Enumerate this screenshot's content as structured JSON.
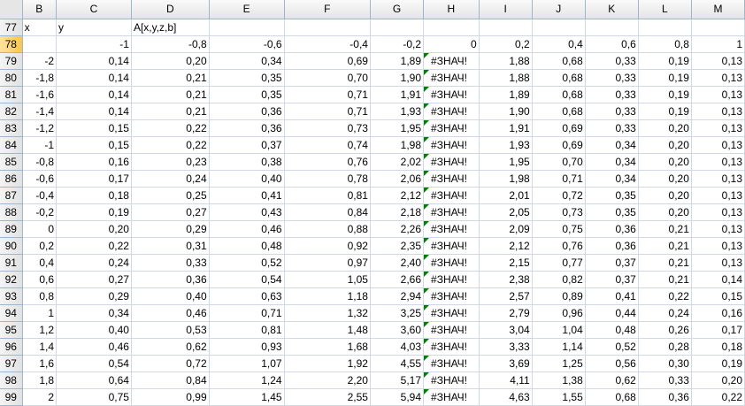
{
  "columns": [
    "B",
    "C",
    "D",
    "E",
    "F",
    "G",
    "H",
    "I",
    "J",
    "K",
    "L",
    "M"
  ],
  "rows": [
    {
      "n": "77",
      "cells": [
        "x",
        "y",
        "A[x,y,z,b]",
        "",
        "",
        "",
        "",
        "",
        "",
        "",
        "",
        ""
      ]
    },
    {
      "n": "78",
      "cells": [
        "",
        "-1",
        "-0,8",
        "-0,6",
        "-0,4",
        "-0,2",
        "0",
        "0,2",
        "0,4",
        "0,6",
        "0,8",
        "1"
      ]
    },
    {
      "n": "79",
      "cells": [
        "-2",
        "0,14",
        "0,20",
        "0,34",
        "0,69",
        "1,89",
        "#ЗНАЧ!",
        "1,88",
        "0,68",
        "0,33",
        "0,19",
        "0,13"
      ]
    },
    {
      "n": "80",
      "cells": [
        "-1,8",
        "0,14",
        "0,21",
        "0,35",
        "0,70",
        "1,90",
        "#ЗНАЧ!",
        "1,88",
        "0,68",
        "0,33",
        "0,19",
        "0,13"
      ]
    },
    {
      "n": "81",
      "cells": [
        "-1,6",
        "0,14",
        "0,21",
        "0,35",
        "0,71",
        "1,91",
        "#ЗНАЧ!",
        "1,89",
        "0,68",
        "0,33",
        "0,19",
        "0,13"
      ]
    },
    {
      "n": "82",
      "cells": [
        "-1,4",
        "0,14",
        "0,21",
        "0,36",
        "0,71",
        "1,93",
        "#ЗНАЧ!",
        "1,90",
        "0,68",
        "0,33",
        "0,19",
        "0,13"
      ]
    },
    {
      "n": "83",
      "cells": [
        "-1,2",
        "0,15",
        "0,22",
        "0,36",
        "0,73",
        "1,95",
        "#ЗНАЧ!",
        "1,91",
        "0,69",
        "0,33",
        "0,20",
        "0,13"
      ]
    },
    {
      "n": "84",
      "cells": [
        "-1",
        "0,15",
        "0,22",
        "0,37",
        "0,74",
        "1,98",
        "#ЗНАЧ!",
        "1,93",
        "0,69",
        "0,34",
        "0,20",
        "0,13"
      ]
    },
    {
      "n": "85",
      "cells": [
        "-0,8",
        "0,16",
        "0,23",
        "0,38",
        "0,76",
        "2,02",
        "#ЗНАЧ!",
        "1,95",
        "0,70",
        "0,34",
        "0,20",
        "0,13"
      ]
    },
    {
      "n": "86",
      "cells": [
        "-0,6",
        "0,17",
        "0,24",
        "0,40",
        "0,78",
        "2,06",
        "#ЗНАЧ!",
        "1,98",
        "0,71",
        "0,34",
        "0,20",
        "0,13"
      ]
    },
    {
      "n": "87",
      "cells": [
        "-0,4",
        "0,18",
        "0,25",
        "0,41",
        "0,81",
        "2,12",
        "#ЗНАЧ!",
        "2,01",
        "0,72",
        "0,35",
        "0,20",
        "0,13"
      ]
    },
    {
      "n": "88",
      "cells": [
        "-0,2",
        "0,19",
        "0,27",
        "0,43",
        "0,84",
        "2,18",
        "#ЗНАЧ!",
        "2,05",
        "0,73",
        "0,35",
        "0,20",
        "0,13"
      ]
    },
    {
      "n": "89",
      "cells": [
        "0",
        "0,20",
        "0,29",
        "0,46",
        "0,88",
        "2,26",
        "#ЗНАЧ!",
        "2,09",
        "0,75",
        "0,36",
        "0,21",
        "0,13"
      ]
    },
    {
      "n": "90",
      "cells": [
        "0,2",
        "0,22",
        "0,31",
        "0,48",
        "0,92",
        "2,35",
        "#ЗНАЧ!",
        "2,12",
        "0,76",
        "0,36",
        "0,21",
        "0,13"
      ]
    },
    {
      "n": "91",
      "cells": [
        "0,4",
        "0,24",
        "0,33",
        "0,52",
        "0,97",
        "2,40",
        "#ЗНАЧ!",
        "2,15",
        "0,77",
        "0,37",
        "0,21",
        "0,13"
      ]
    },
    {
      "n": "92",
      "cells": [
        "0,6",
        "0,27",
        "0,36",
        "0,54",
        "1,05",
        "2,66",
        "#ЗНАЧ!",
        "2,38",
        "0,82",
        "0,37",
        "0,21",
        "0,14"
      ]
    },
    {
      "n": "93",
      "cells": [
        "0,8",
        "0,29",
        "0,40",
        "0,63",
        "1,18",
        "2,94",
        "#ЗНАЧ!",
        "2,57",
        "0,89",
        "0,41",
        "0,22",
        "0,15"
      ]
    },
    {
      "n": "94",
      "cells": [
        "1",
        "0,34",
        "0,46",
        "0,71",
        "1,32",
        "3,25",
        "#ЗНАЧ!",
        "2,79",
        "0,96",
        "0,44",
        "0,24",
        "0,16"
      ]
    },
    {
      "n": "95",
      "cells": [
        "1,2",
        "0,40",
        "0,53",
        "0,81",
        "1,48",
        "3,60",
        "#ЗНАЧ!",
        "3,04",
        "1,04",
        "0,48",
        "0,26",
        "0,17"
      ]
    },
    {
      "n": "96",
      "cells": [
        "1,4",
        "0,46",
        "0,62",
        "0,93",
        "1,68",
        "4,03",
        "#ЗНАЧ!",
        "3,33",
        "1,14",
        "0,52",
        "0,28",
        "0,18"
      ]
    },
    {
      "n": "97",
      "cells": [
        "1,6",
        "0,54",
        "0,72",
        "1,07",
        "1,92",
        "4,55",
        "#ЗНАЧ!",
        "3,69",
        "1,25",
        "0,56",
        "0,30",
        "0,19"
      ]
    },
    {
      "n": "98",
      "cells": [
        "1,8",
        "0,64",
        "0,84",
        "1,24",
        "2,20",
        "5,17",
        "#ЗНАЧ!",
        "4,11",
        "1,38",
        "0,62",
        "0,33",
        "0,20"
      ]
    },
    {
      "n": "99",
      "cells": [
        "2",
        "0,75",
        "0,99",
        "1,45",
        "2,55",
        "5,94",
        "#ЗНАЧ!",
        "4,63",
        "1,55",
        "0,68",
        "0,36",
        "0,22"
      ]
    }
  ],
  "active_row": "78",
  "colors": {
    "error_indicator": "#008000",
    "gridline": "#d0d7e5",
    "header_border": "#9eb6ce",
    "active_header": "#f9c54e"
  }
}
